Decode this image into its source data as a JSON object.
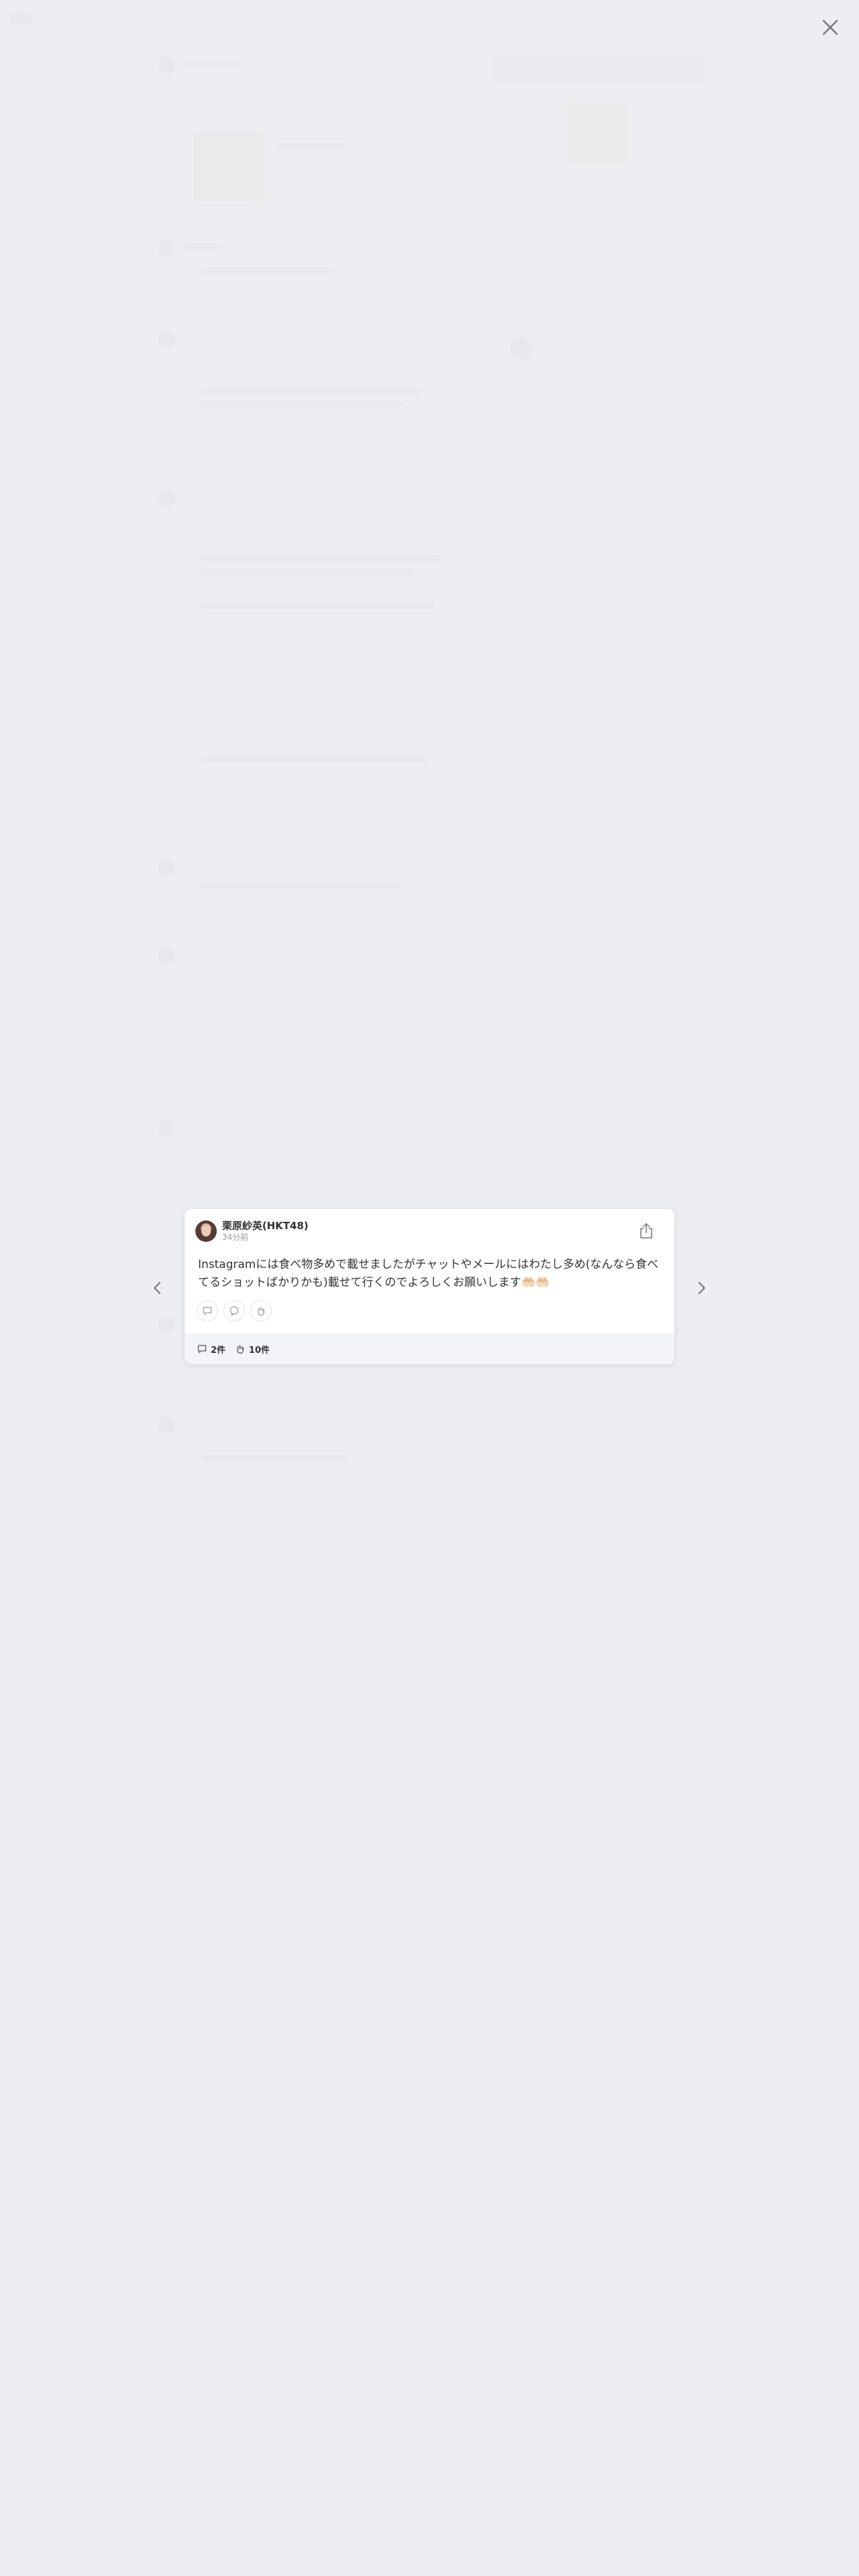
{
  "post": {
    "author": "栗原紗英(HKT48)",
    "time": "34分前",
    "text": "Instagramには食べ物多めで載せましたがチャットやメールにはわたし多め(なんなら食べてるショットばかりかも)載せて行くのでよろしくお願いします🤲🏻🤲🏻",
    "comments_count": "2件",
    "reactions_count": "10件"
  },
  "icons": {
    "close": "close-icon",
    "share": "share-icon",
    "prev": "chevron-left-icon",
    "next": "chevron-right-icon",
    "comment": "comment-icon",
    "quote": "speech-bubble-icon",
    "reaction": "hand-icon"
  },
  "colors": {
    "overlay_background": "#eceef1",
    "card_background": "#ffffff",
    "footer_background": "#f2f4f7",
    "icon_gray": "#888888"
  }
}
